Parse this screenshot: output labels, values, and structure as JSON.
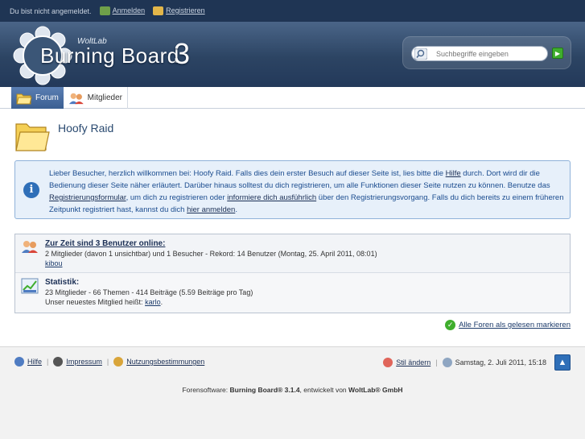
{
  "topbar": {
    "status_text": "Du bist nicht angemeldet.",
    "login_label": "Anmelden",
    "register_label": "Registrieren"
  },
  "header": {
    "logo_brand": "WoltLab",
    "logo_product": "Burning Board",
    "logo_version": "3",
    "search_placeholder": "Suchbegriffe eingeben",
    "search_go_icon": "arrow-right-icon"
  },
  "tabs": [
    {
      "label": "Forum",
      "active": true,
      "icon": "folder-icon"
    },
    {
      "label": "Mitglieder",
      "active": false,
      "icon": "members-icon"
    }
  ],
  "main": {
    "title": "Hoofy Raid",
    "info": {
      "t1": "Lieber Besucher, herzlich willkommen bei: Hoofy Raid. Falls dies dein erster Besuch auf dieser Seite ist, lies bitte die ",
      "link_help": "Hilfe",
      "t2": " durch. Dort wird dir die Bedienung dieser Seite näher erläutert. Darüber hinaus solltest du dich registrieren, um alle Funktionen dieser Seite nutzen zu können. Benutze das ",
      "link_form": "Registrierungsformular",
      "t3": ", um dich zu registrieren oder ",
      "link_more": "informiere dich ausführlich",
      "t4": " über den Registrierungsvorgang. Falls du dich bereits zu einem früheren Zeitpunkt registriert hast, kannst du dich ",
      "link_login": "hier anmelden",
      "t5": "."
    },
    "online": {
      "title": "Zur Zeit sind 3 Benutzer online:",
      "detail": "2 Mitglieder (davon 1 unsichtbar) und 1 Besucher - Rekord: 14 Benutzer (Montag, 25. April 2011, 08:01)",
      "user": "kibou"
    },
    "statistics": {
      "title": "Statistik:",
      "detail": "23 Mitglieder - 66 Themen - 414 Beiträge (5.59 Beiträge pro Tag)",
      "newest_prefix": "Unser neuestes Mitglied heißt: ",
      "newest_user": "karlo",
      "newest_suffix": "."
    },
    "mark_read_label": "Alle Foren als gelesen markieren"
  },
  "footer": {
    "links": [
      "Hilfe",
      "Impressum",
      "Nutzungsbestimmungen"
    ],
    "style_label": "Stil ändern",
    "datetime": "Samstag, 2. Juli 2011, 15:18",
    "credits_prefix": "Forensoftware: ",
    "credits_product": "Burning Board® 3.1.4",
    "credits_mid": ", entwickelt von ",
    "credits_company": "WoltLab® GmbH"
  },
  "colors": {
    "topbar": "#1f3554",
    "header_dark": "#23395a",
    "tab_active": "#3b5f92",
    "info_bg": "#e7f0fa",
    "info_text": "#1b4c8f",
    "link": "#1b2f55"
  }
}
